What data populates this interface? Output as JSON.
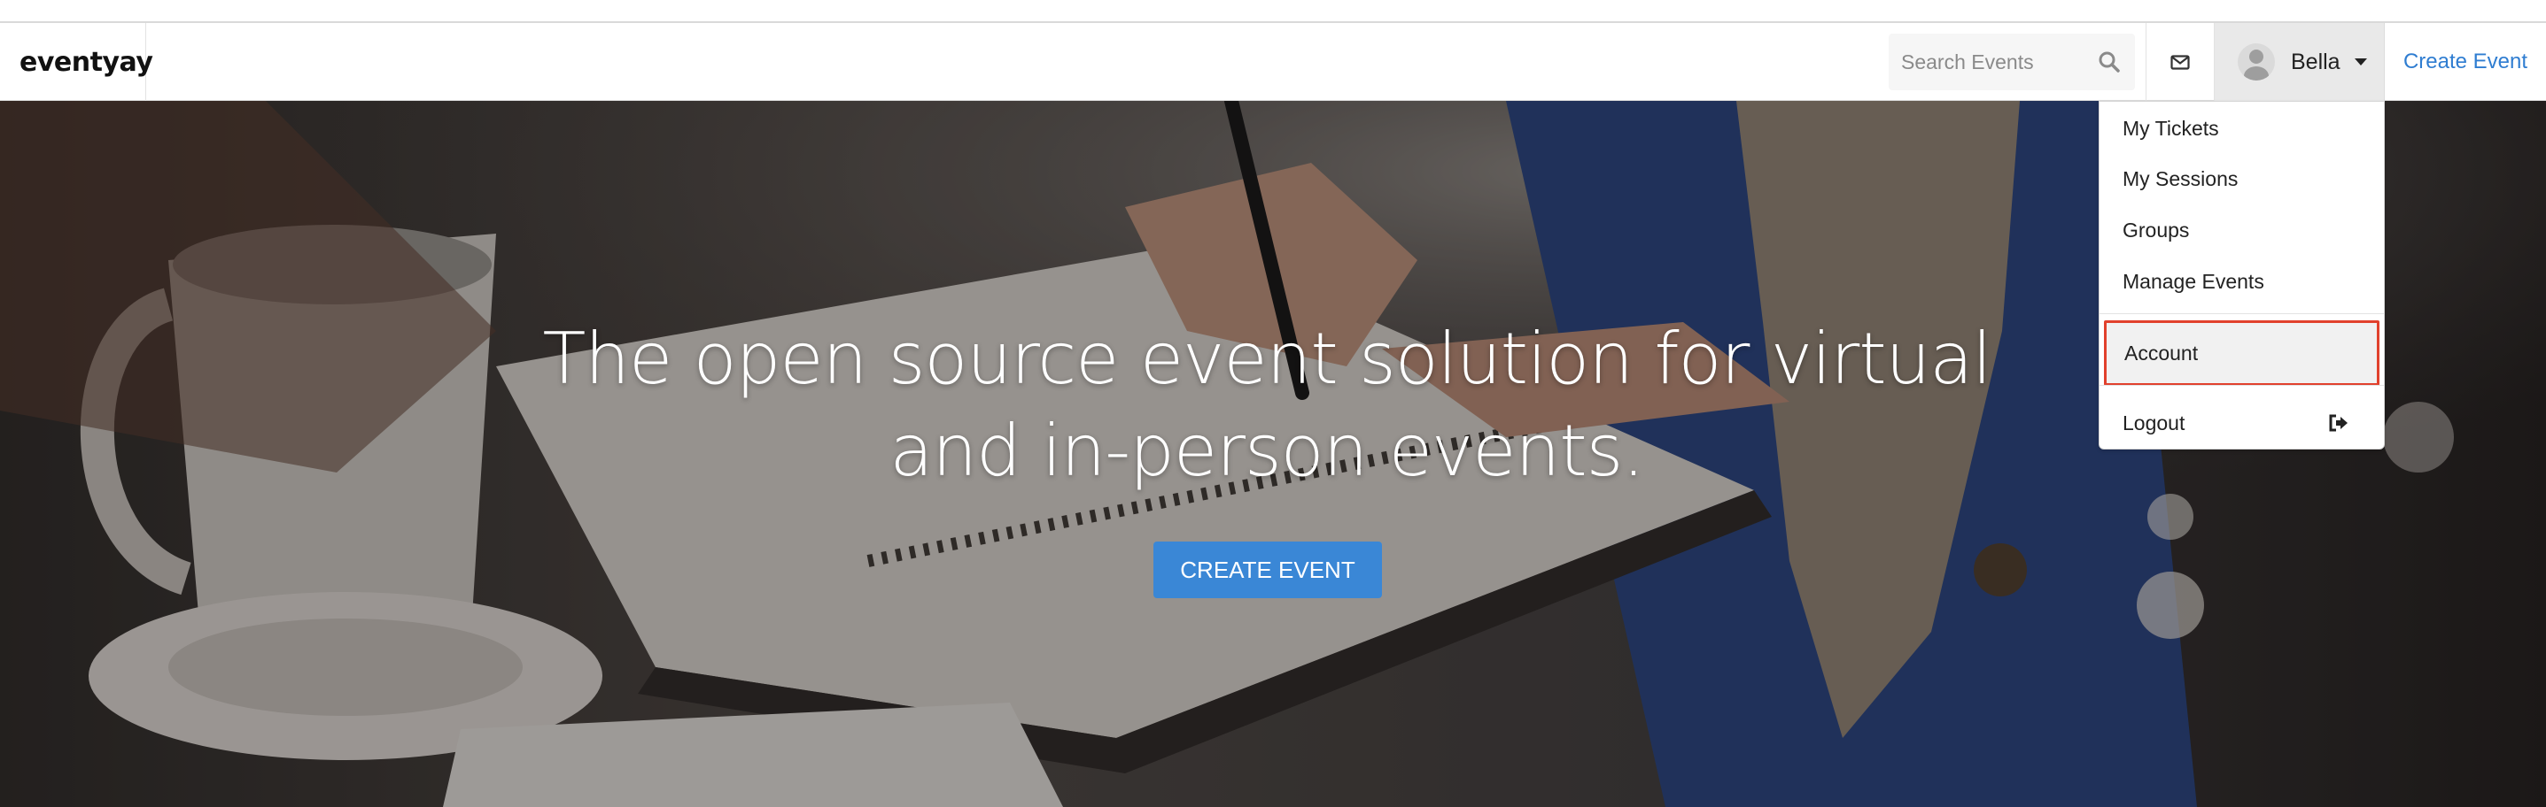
{
  "app": {
    "logo": "eventyay"
  },
  "header": {
    "search_placeholder": "Search Events",
    "user_name": "Bella",
    "create_event_link": "Create Event"
  },
  "hero": {
    "headline": "The open source event solution for virtual and in-person events.",
    "cta_label": "CREATE EVENT"
  },
  "dropdown": {
    "items": [
      "My Tickets",
      "My Sessions",
      "Groups",
      "Manage Events",
      "Account",
      "Logout"
    ],
    "highlighted": "Account"
  },
  "colors": {
    "accent": "#3a87d6",
    "link": "#2f7dd1",
    "highlight": "#e1412d"
  },
  "icons": [
    "search-icon",
    "mail-icon",
    "avatar-icon",
    "caret-down-icon",
    "logout-icon"
  ]
}
